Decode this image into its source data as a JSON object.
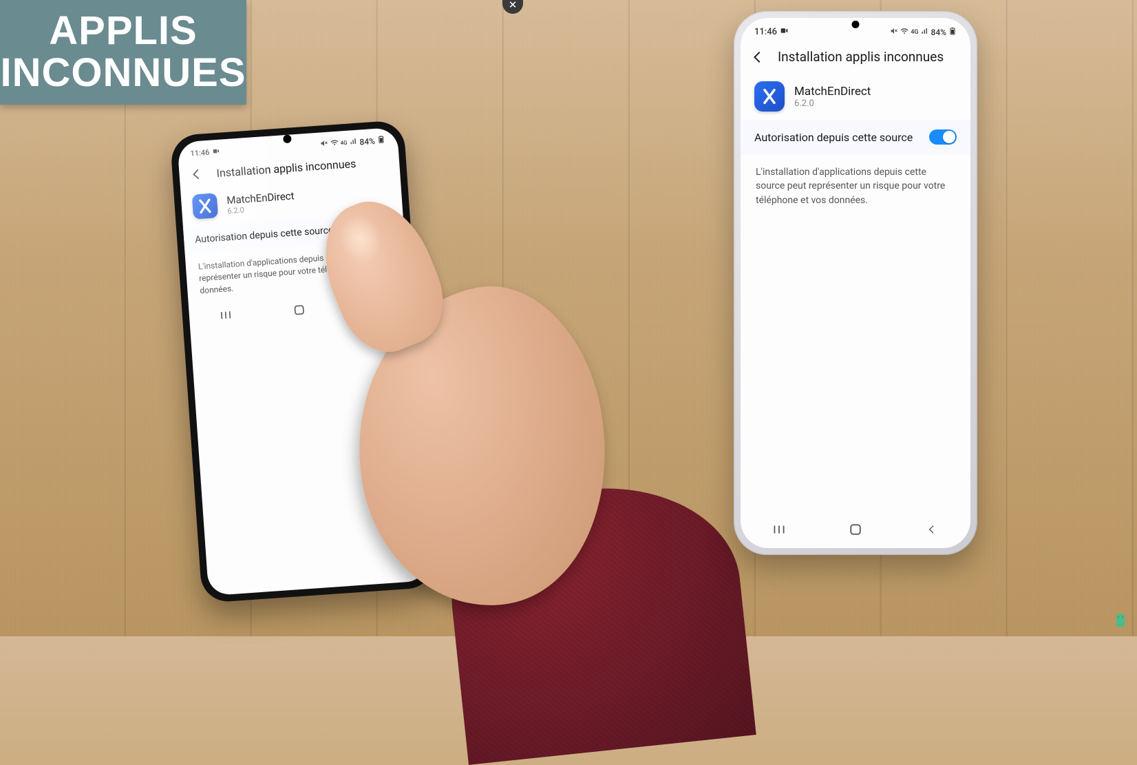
{
  "overlay": {
    "title_line1": "APPLIS",
    "title_line2": "INCONNUES"
  },
  "status": {
    "time": "11:46",
    "battery_text": "84%"
  },
  "settings": {
    "page_title": "Installation applis inconnues",
    "app_name": "MatchEnDirect",
    "app_version": "6.2.0",
    "toggle_label": "Autorisation depuis cette source",
    "toggle_on": true,
    "warning_text": "L'installation d'applications depuis cette source peut représenter un risque pour votre téléphone et vos données."
  },
  "colors": {
    "accent": "#1a8cff",
    "badge_bg": "#6a8b8f",
    "app_icon_bg": "#2558d4"
  }
}
